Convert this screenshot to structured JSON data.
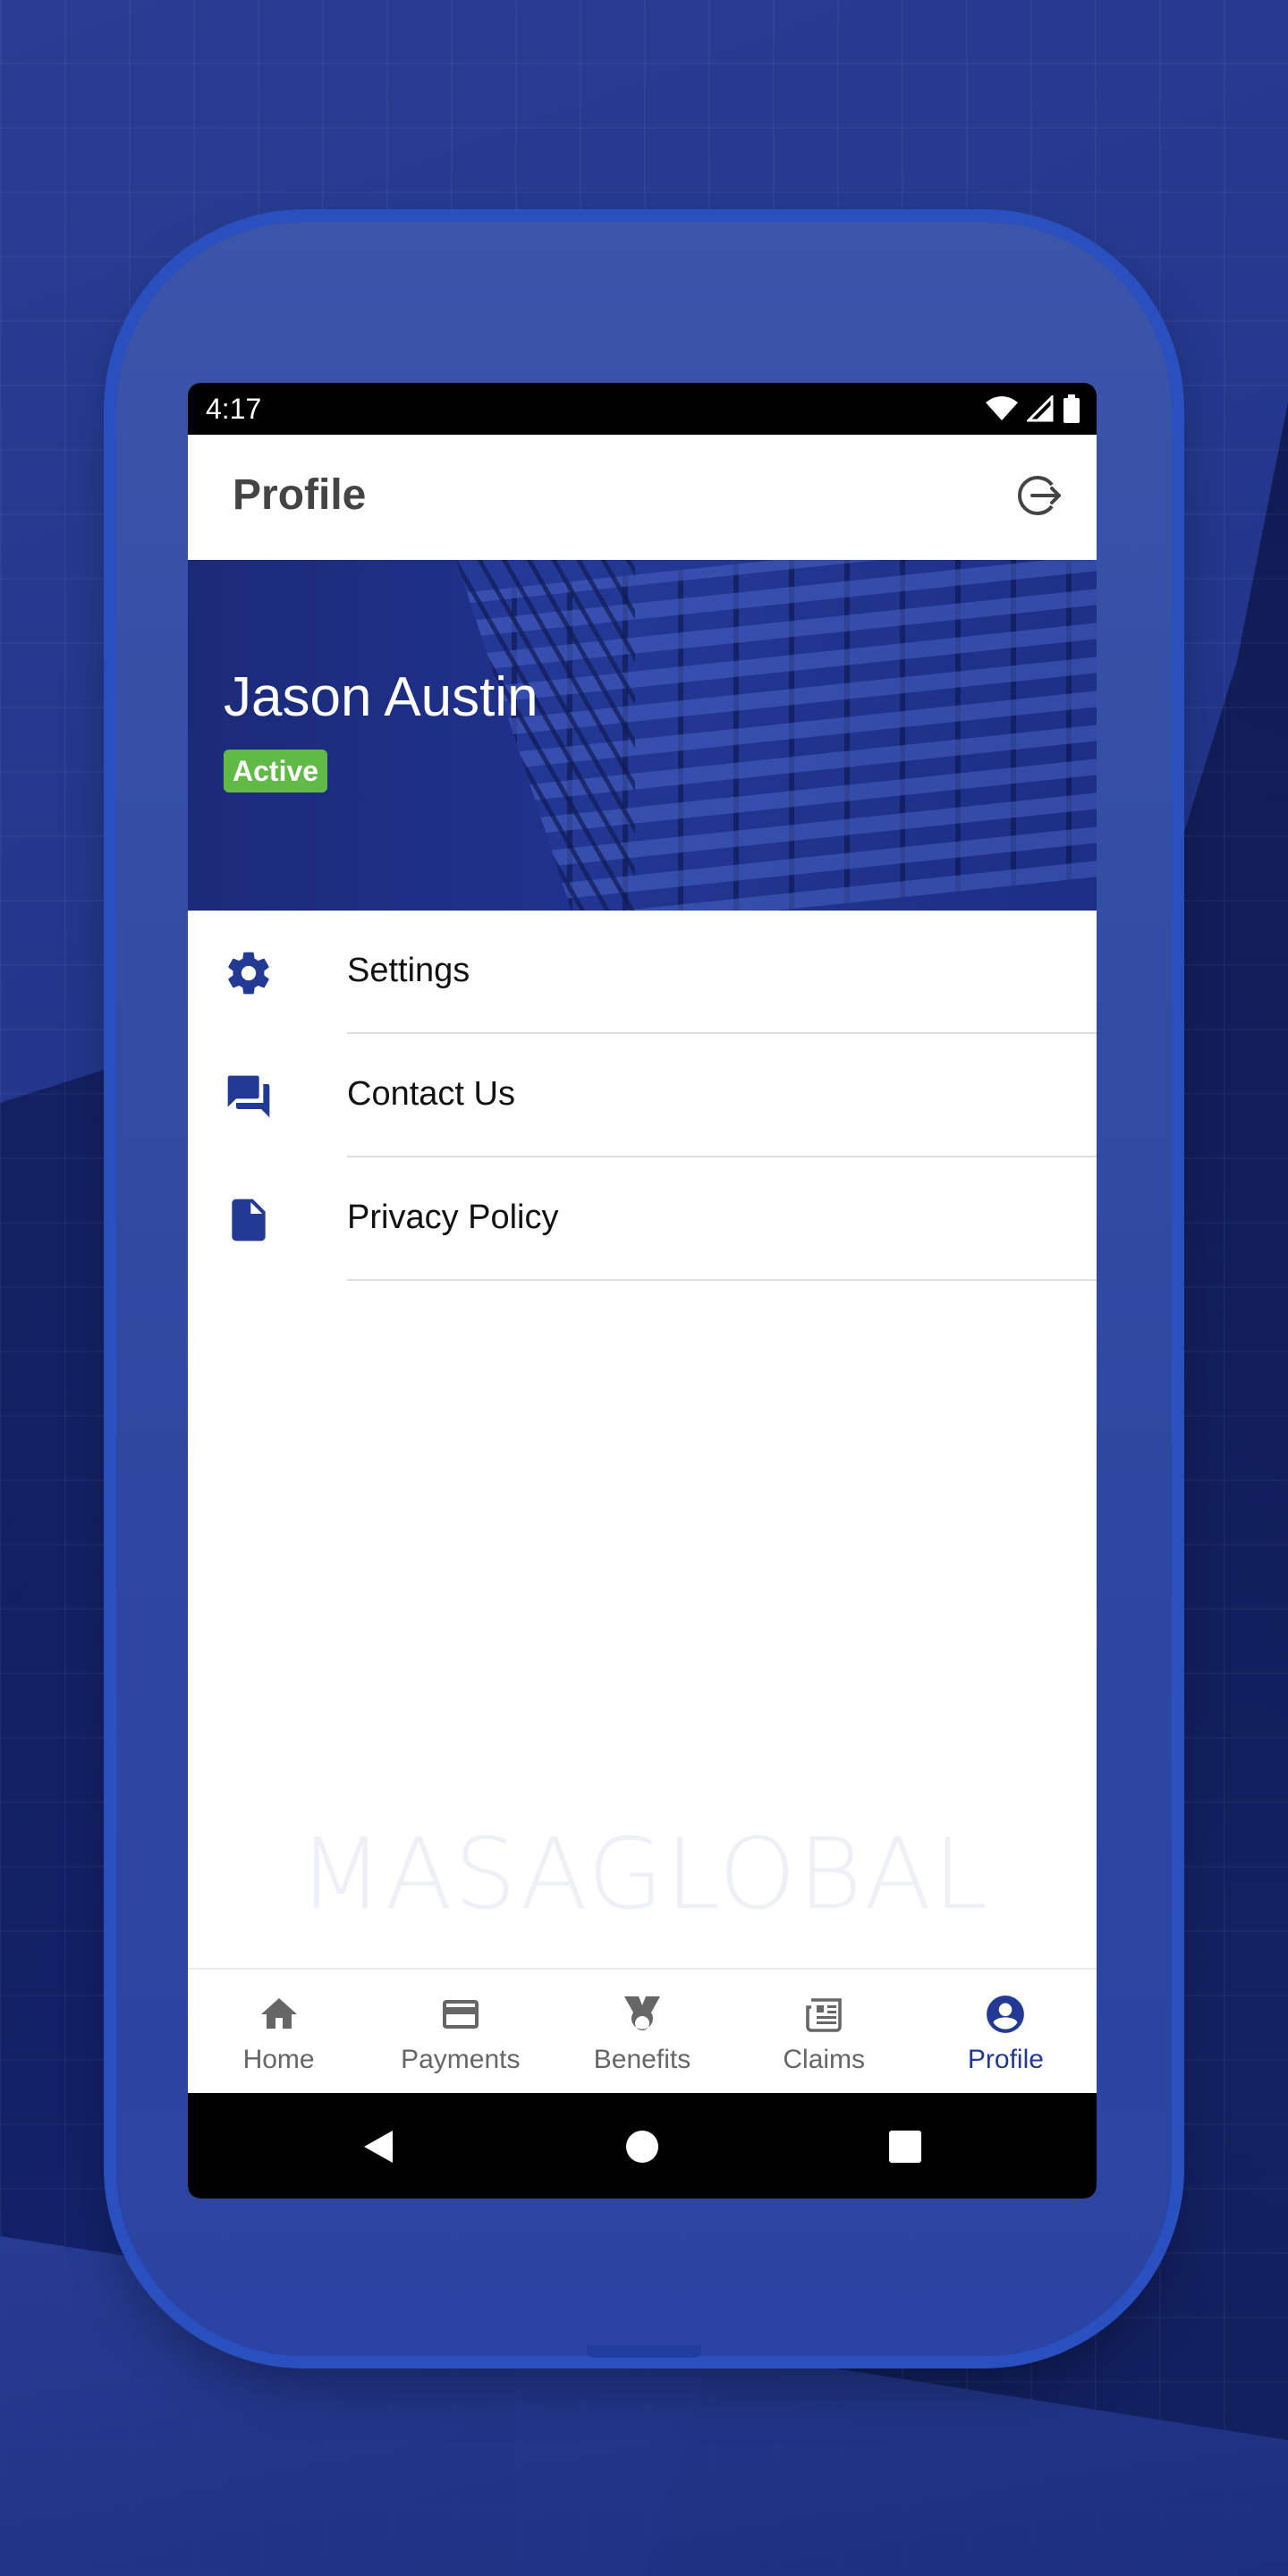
{
  "status_bar": {
    "time": "4:17"
  },
  "app_bar": {
    "title": "Profile",
    "logout_icon": "logout-icon"
  },
  "profile": {
    "name": "Jason Austin",
    "status": "Active",
    "status_color": "#5fbb46"
  },
  "menu": [
    {
      "label": "Settings",
      "icon": "gear-icon"
    },
    {
      "label": "Contact Us",
      "icon": "chat-icon"
    },
    {
      "label": "Privacy Policy",
      "icon": "document-icon"
    }
  ],
  "watermark": "MASAGLOBAL",
  "bottom_nav": [
    {
      "label": "Home",
      "icon": "home-icon",
      "active": false
    },
    {
      "label": "Payments",
      "icon": "card-icon",
      "active": false
    },
    {
      "label": "Benefits",
      "icon": "medal-icon",
      "active": false
    },
    {
      "label": "Claims",
      "icon": "newspaper-icon",
      "active": false
    },
    {
      "label": "Profile",
      "icon": "account-icon",
      "active": true
    }
  ],
  "colors": {
    "accent": "#223a94",
    "icon_gray": "#666666",
    "background_blue": "#24388e"
  }
}
